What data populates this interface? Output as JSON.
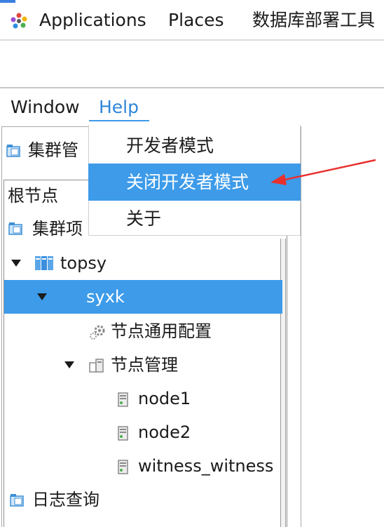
{
  "top_panel": {
    "applications": "Applications",
    "places": "Places",
    "app_title": "数据库部署工具"
  },
  "menubar": {
    "window": "Window",
    "help": "Help"
  },
  "help_menu": {
    "items": [
      "开发者模式",
      "关闭开发者模式",
      "关于"
    ],
    "highlighted_index": 1
  },
  "panel": {
    "tab_label": "集群管"
  },
  "tree": {
    "root": "根节点",
    "cluster_items": "集群项",
    "cluster_name": "topsy",
    "instance": "syxk",
    "node_general_config": "节点通用配置",
    "node_management": "节点管理",
    "nodes": [
      "node1",
      "node2",
      "witness_witness"
    ],
    "log_query": "日志查询"
  },
  "colors": {
    "selection": "#3d9be9",
    "accent": "#3e9ae6",
    "annotation_arrow": "#e8312f"
  }
}
